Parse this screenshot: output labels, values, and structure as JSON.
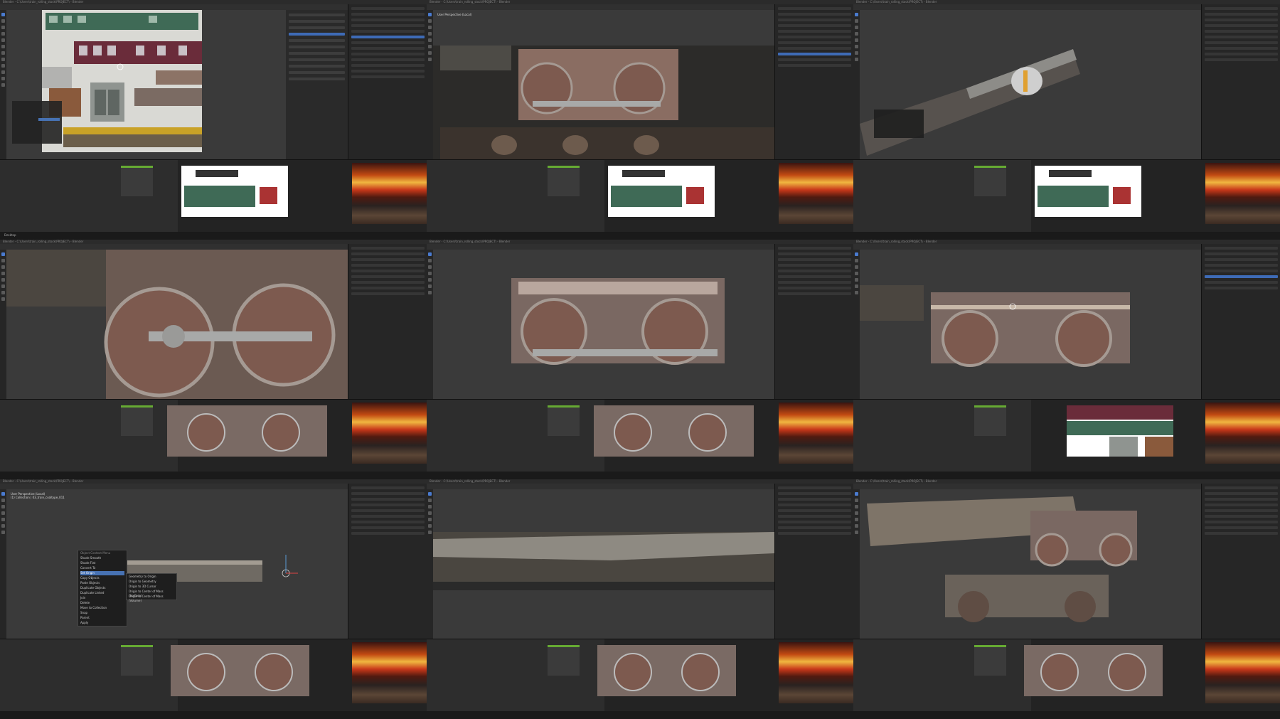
{
  "window": {
    "title": "Blender - C:\\Users\\train_rolling_stock\\PROJECT\\ - Blender",
    "taskbar_label": "Desktop"
  },
  "viewport": {
    "header_line1": "User Perspective (Local)",
    "header_line2": "(1) Collection | 03_train_coaltype_011"
  },
  "context_menu": {
    "title": "Object Context Menu",
    "items": [
      "Shade Smooth",
      "Shade Flat",
      "Convert To",
      "Set Origin",
      "Copy Objects",
      "Paste Objects",
      "Duplicate Objects",
      "Duplicate Linked",
      "Join",
      "Delete",
      "Move to Collection",
      "Snap",
      "Parent",
      "Apply"
    ],
    "submenu": [
      "Geometry to Origin",
      "Origin to Geometry",
      "Origin to 3D Cursor",
      "Origin to Center of Mass (Surface)",
      "Origin to Center of Mass (Volume)"
    ]
  },
  "colors": {
    "blender_bg": "#3a3a3a",
    "accent_blue": "#4772b3",
    "rust": "#8a5a4a",
    "steel": "#a8a9a8"
  }
}
